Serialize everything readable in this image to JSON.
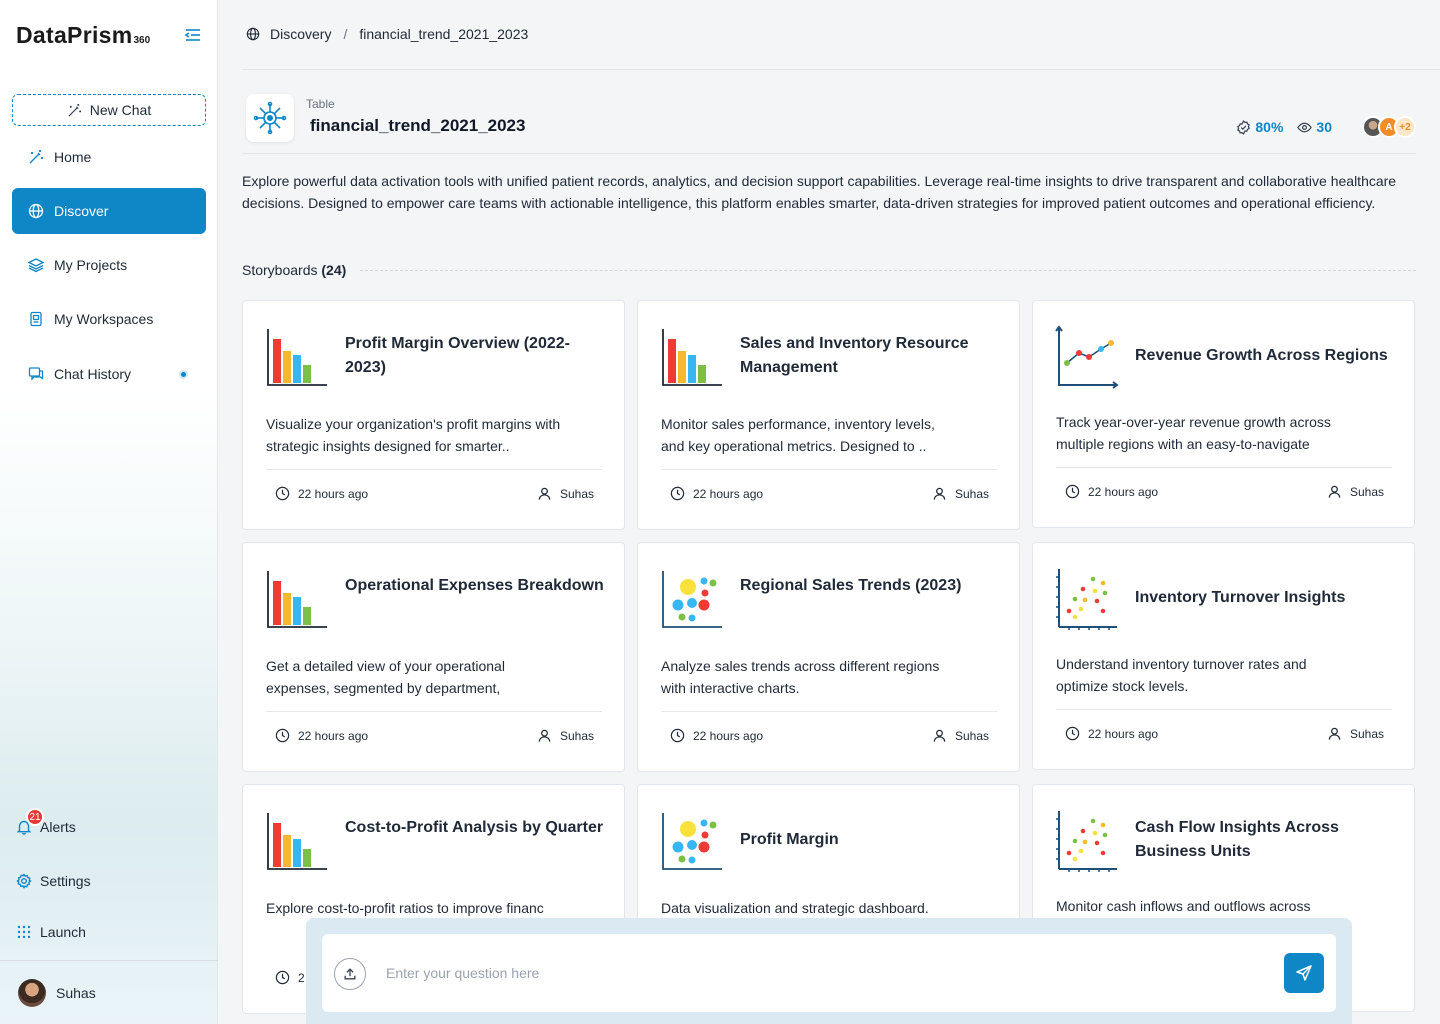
{
  "app": {
    "logo_text": "DataPrism",
    "logo_sup": "360"
  },
  "sidebar": {
    "new_chat": "New Chat",
    "items": [
      {
        "label": "Home",
        "icon": "magic-wand-icon"
      },
      {
        "label": "Discover",
        "icon": "globe-icon"
      },
      {
        "label": "My Projects",
        "icon": "layers-icon"
      },
      {
        "label": "My Workspaces",
        "icon": "workspace-icon"
      },
      {
        "label": "Chat History",
        "icon": "chat-icon"
      }
    ],
    "alerts": {
      "label": "Alerts",
      "count": "21"
    },
    "settings": "Settings",
    "launch": "Launch",
    "user": "Suhas"
  },
  "breadcrumb": {
    "root": "Discovery",
    "sep": "/",
    "current": "financial_trend_2021_2023"
  },
  "header": {
    "tag": "Table",
    "name": "financial_trend_2021_2023",
    "quality": "80%",
    "views": "30",
    "avatar_initial": "A",
    "extra_count": "+2"
  },
  "description": "Explore powerful data activation tools with unified patient records, analytics, and decision support capabilities. Leverage real-time insights to drive transparent and collaborative healthcare decisions. Designed to empower care teams with actionable intelligence, this platform enables smarter, data-driven strategies for improved patient outcomes and operational efficiency.",
  "storyboards": {
    "label": "Storyboards",
    "count": "(24)",
    "cards": [
      {
        "title": "Profit Margin Overview (2022-2023)",
        "desc": "Visualize your organization's profit margins with strategic insights designed for smarter..",
        "time": "22 hours ago",
        "user": "Suhas",
        "icon": "bar-chart-icon"
      },
      {
        "title": "Sales and Inventory Resource Management",
        "desc": "Monitor sales performance, inventory levels, and key operational metrics. Designed to ..",
        "time": "22 hours ago",
        "user": "Suhas",
        "icon": "bar-chart-icon"
      },
      {
        "title": "Revenue Growth Across Regions",
        "desc": "Track year-over-year revenue growth across multiple regions with an easy-to-navigate",
        "time": "22 hours ago",
        "user": "Suhas",
        "icon": "line-chart-icon"
      },
      {
        "title": "Operational Expenses Breakdown",
        "desc": "Get a detailed view of your operational expenses, segmented by department,",
        "time": "22 hours ago",
        "user": "Suhas",
        "icon": "bar-chart-icon"
      },
      {
        "title": "Regional Sales Trends (2023)",
        "desc": "Analyze sales trends across different regions with interactive charts.",
        "time": "22 hours ago",
        "user": "Suhas",
        "icon": "bubble-chart-icon"
      },
      {
        "title": "Inventory Turnover Insights",
        "desc": "Understand inventory turnover rates and optimize stock levels.",
        "time": "22 hours ago",
        "user": "Suhas",
        "icon": "scatter-chart-icon"
      },
      {
        "title": "Cost-to-Profit Analysis by Quarter",
        "desc": "Explore cost-to-profit ratios to improve financ",
        "time": "2",
        "user": "",
        "icon": "bar-chart-icon"
      },
      {
        "title": "Profit Margin",
        "desc": "Data visualization and strategic dashboard.",
        "time": "",
        "user": "",
        "icon": "bubble-chart-icon"
      },
      {
        "title": "Cash Flow Insights Across Business Units",
        "desc": "Monitor cash inflows and outflows across",
        "time": "",
        "user": "",
        "icon": "scatter-chart-icon"
      }
    ]
  },
  "ask": {
    "placeholder": "Enter your question here"
  },
  "colors": {
    "accent": "#0f86c6",
    "alert": "#e53935"
  }
}
